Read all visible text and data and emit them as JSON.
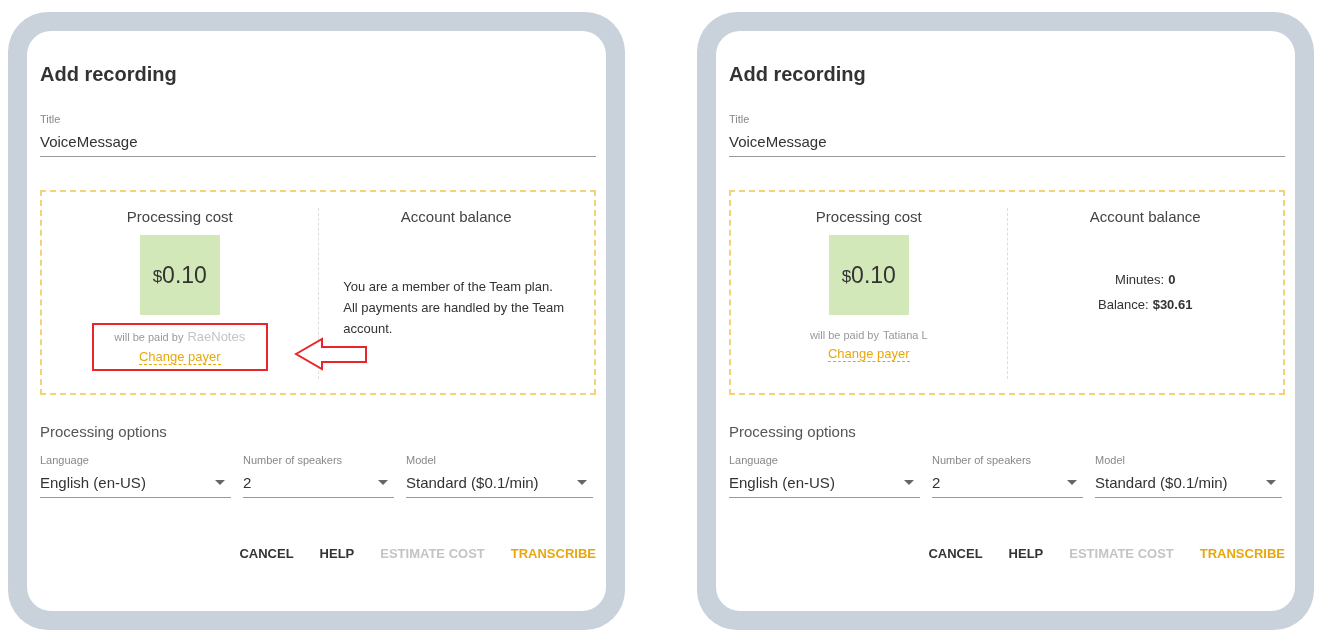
{
  "dialogs": [
    {
      "title": "Add recording",
      "field": {
        "label": "Title",
        "value": "VoiceMessage"
      },
      "cost": {
        "heading": "Processing cost",
        "currency": "$",
        "amount": "0.10",
        "paid_by": "will be paid by",
        "payer": "RaeNotes",
        "payer_faded": true,
        "change": "Change payer",
        "highlighted": true
      },
      "balance": {
        "heading": "Account balance",
        "kind": "note",
        "text": "You are a member of the Team plan. All payments are handled by the Team account."
      },
      "options": {
        "heading": "Processing options",
        "selects": [
          {
            "label": "Language",
            "value": "English (en-US)"
          },
          {
            "label": "Number of speakers",
            "value": "2"
          },
          {
            "label": "Model",
            "value": "Standard ($0.1/min)"
          }
        ]
      },
      "buttons": [
        {
          "label": "CANCEL",
          "disabled": false,
          "primary": false
        },
        {
          "label": "HELP",
          "disabled": false,
          "primary": false
        },
        {
          "label": "ESTIMATE COST",
          "disabled": true,
          "primary": false
        },
        {
          "label": "TRANSCRIBE",
          "disabled": false,
          "primary": true
        }
      ]
    },
    {
      "title": "Add recording",
      "field": {
        "label": "Title",
        "value": "VoiceMessage"
      },
      "cost": {
        "heading": "Processing cost",
        "currency": "$",
        "amount": "0.10",
        "paid_by": "will be paid by",
        "payer": "Tatiana L",
        "payer_faded": false,
        "change": "Change payer",
        "highlighted": false
      },
      "balance": {
        "heading": "Account balance",
        "kind": "figures",
        "lines": [
          {
            "label": "Minutes:",
            "value": "0"
          },
          {
            "label": "Balance:",
            "value": "$30.61"
          }
        ]
      },
      "options": {
        "heading": "Processing options",
        "selects": [
          {
            "label": "Language",
            "value": "English (en-US)"
          },
          {
            "label": "Number of speakers",
            "value": "2"
          },
          {
            "label": "Model",
            "value": "Standard ($0.1/min)"
          }
        ]
      },
      "buttons": [
        {
          "label": "CANCEL",
          "disabled": false,
          "primary": false
        },
        {
          "label": "HELP",
          "disabled": false,
          "primary": false
        },
        {
          "label": "ESTIMATE COST",
          "disabled": true,
          "primary": false
        },
        {
          "label": "TRANSCRIBE",
          "disabled": false,
          "primary": true
        }
      ]
    }
  ]
}
